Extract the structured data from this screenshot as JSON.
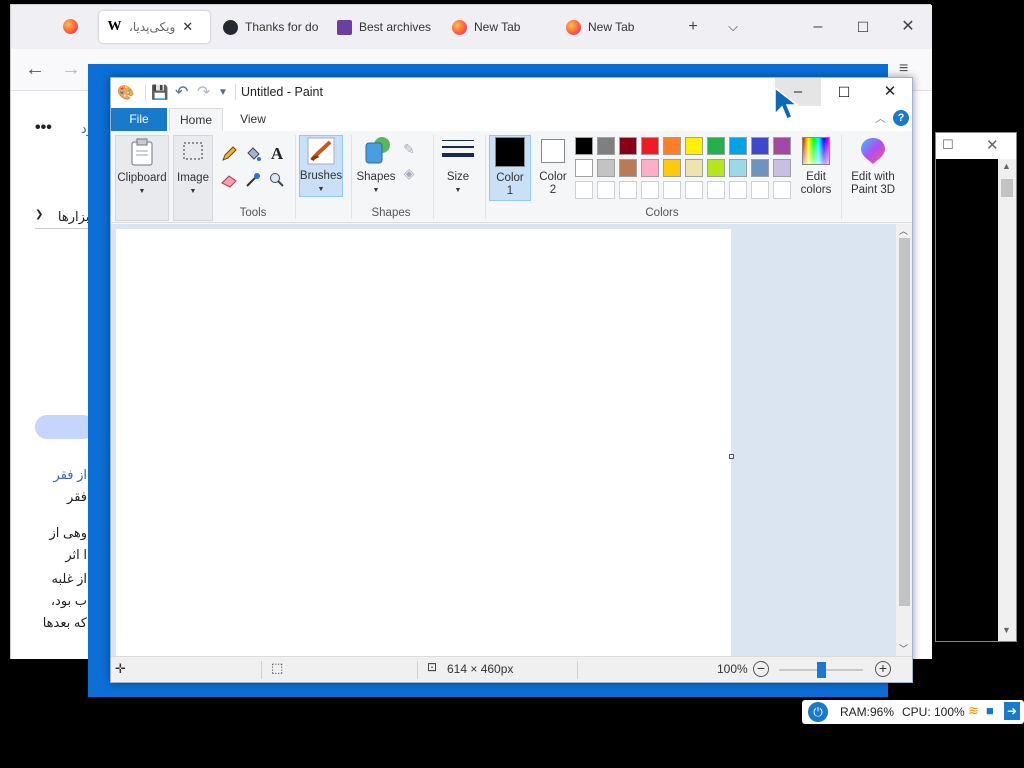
{
  "firefox": {
    "tabs": [
      {
        "label": "ویکی‌پدیا،",
        "icon": "wikipedia-w-icon",
        "active": true
      },
      {
        "label": "Thanks for do",
        "icon": "github-icon"
      },
      {
        "label": "Best archives",
        "icon": "archive-icon"
      },
      {
        "label": "New Tab",
        "icon": "firefox-icon"
      },
      {
        "label": "New Tab",
        "icon": "firefox-icon"
      }
    ],
    "page": {
      "menu_dots": "•••",
      "header_fragment": "ود",
      "tools_dropdown": "ابزارها",
      "text_lines": [
        "از فقر",
        "فقر",
        "وهی از",
        "ا اثر",
        "از غلبه",
        "ب بود،",
        "که بعدها"
      ]
    }
  },
  "paint": {
    "title": "Untitled - Paint",
    "tabs": {
      "file": "File",
      "home": "Home",
      "view": "View"
    },
    "ribbon": {
      "clipboard": "Clipboard",
      "image": "Image",
      "tools": "Tools",
      "brushes": "Brushes",
      "shapes_btn": "Shapes",
      "shapes_group": "Shapes",
      "size": "Size",
      "color1": [
        "Color",
        "1"
      ],
      "color2": [
        "Color",
        "2"
      ],
      "colors_group": "Colors",
      "edit_colors": [
        "Edit",
        "colors"
      ],
      "paint3d": [
        "Edit with",
        "Paint 3D"
      ]
    },
    "palette_row1": [
      "#000000",
      "#7f7f7f",
      "#880015",
      "#ed1c24",
      "#ff7f27",
      "#fff200",
      "#22b14c",
      "#00a2e8",
      "#3f48cc",
      "#a349a4"
    ],
    "palette_row2": [
      "#ffffff",
      "#c3c3c3",
      "#b97a57",
      "#ffaec9",
      "#ffc90e",
      "#efe4b0",
      "#b5e61d",
      "#99d9ea",
      "#7092be",
      "#c8bfe7"
    ],
    "status": {
      "canvas_size": "614 × 460px",
      "zoom": "100%"
    }
  },
  "tray": {
    "ram": "RAM:96%",
    "cpu": "CPU: 100%"
  }
}
